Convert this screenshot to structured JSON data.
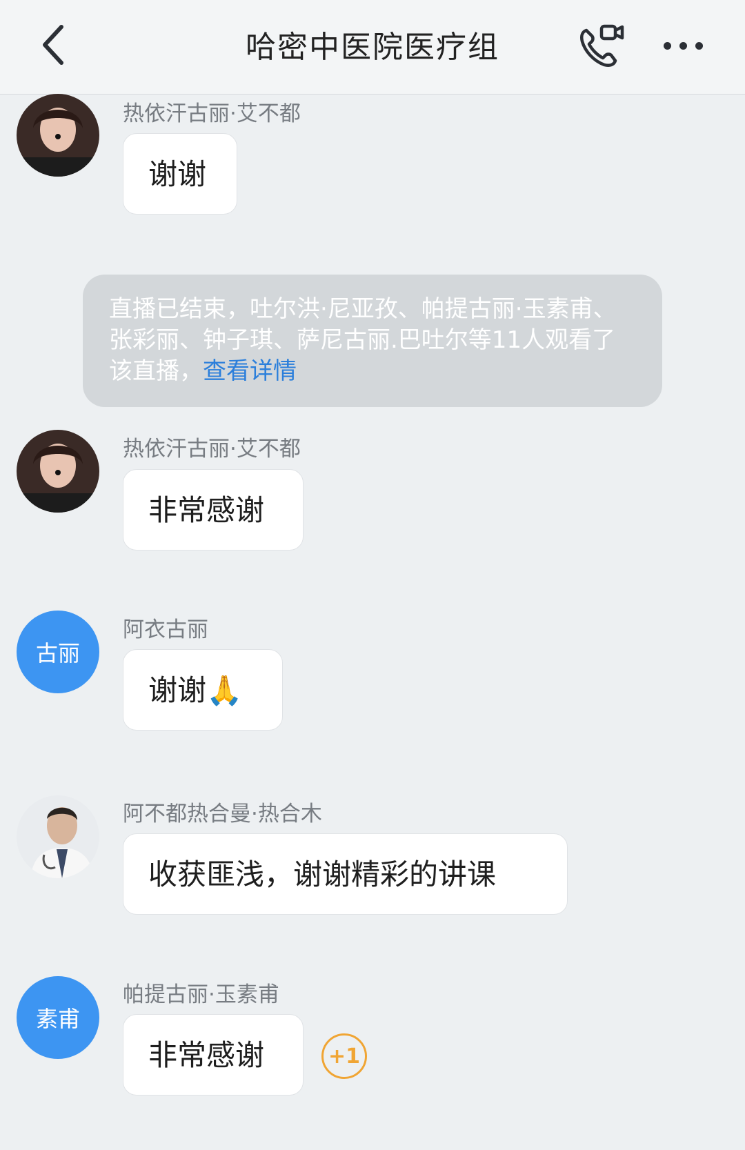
{
  "header": {
    "title": "哈密中医院医疗组",
    "back_icon": "chevron-left-icon",
    "call_icon": "video-phone-icon",
    "more_icon": "more-horizontal-icon"
  },
  "messages": [
    {
      "sender": "热依汗古丽·艾不都",
      "text": "谢谢",
      "avatar": "photo"
    },
    {
      "sender": "热依汗古丽·艾不都",
      "text": "非常感谢",
      "avatar": "photo"
    },
    {
      "sender": "阿衣古丽",
      "text": "谢谢🙏",
      "avatar_text": "古丽"
    },
    {
      "sender": "阿不都热合曼·热合木",
      "text": "收获匪浅，谢谢精彩的讲课",
      "avatar": "photo"
    },
    {
      "sender": "帕提古丽·玉素甫",
      "text": "非常感谢",
      "avatar_text": "素甫",
      "reaction": "+1"
    }
  ],
  "system_notice": {
    "text": "直播已结束，吐尔洪·尼亚孜、帕提古丽·玉素甫、张彩丽、钟子琪、萨尼古丽.巴吐尔等11人观看了该直播，",
    "link": "查看详情"
  },
  "colors": {
    "accent_blue": "#3d95f2",
    "link_blue": "#2b7fdb",
    "reaction_orange": "#f0a534",
    "background": "#edf0f2"
  }
}
